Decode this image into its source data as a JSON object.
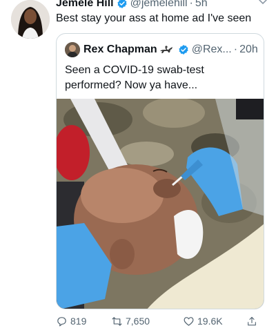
{
  "tweet": {
    "author_name": "Jemele Hill",
    "handle": "@jemelehill",
    "separator": "·",
    "time": "5h",
    "text": "Best stay your ass at home ad I've seen"
  },
  "quoted_tweet": {
    "author_name": "Rex Chapman",
    "handle": "@Rex...",
    "separator": "·",
    "time": "20h",
    "text": "Seen a COVID-19 swab-test performed? Now ya have..."
  },
  "actions": {
    "replies": "819",
    "retweets": "7,650",
    "likes": "19.6K"
  },
  "icons": {
    "verified": "verified-badge-icon",
    "caret": "chevron-down-icon",
    "horse": "horse-rider-icon",
    "reply": "reply-icon",
    "retweet": "retweet-icon",
    "like": "heart-icon",
    "share": "share-icon"
  },
  "colors": {
    "verified_blue": "#1d9bf0",
    "muted_text": "#536471",
    "border": "#cfd9de"
  }
}
